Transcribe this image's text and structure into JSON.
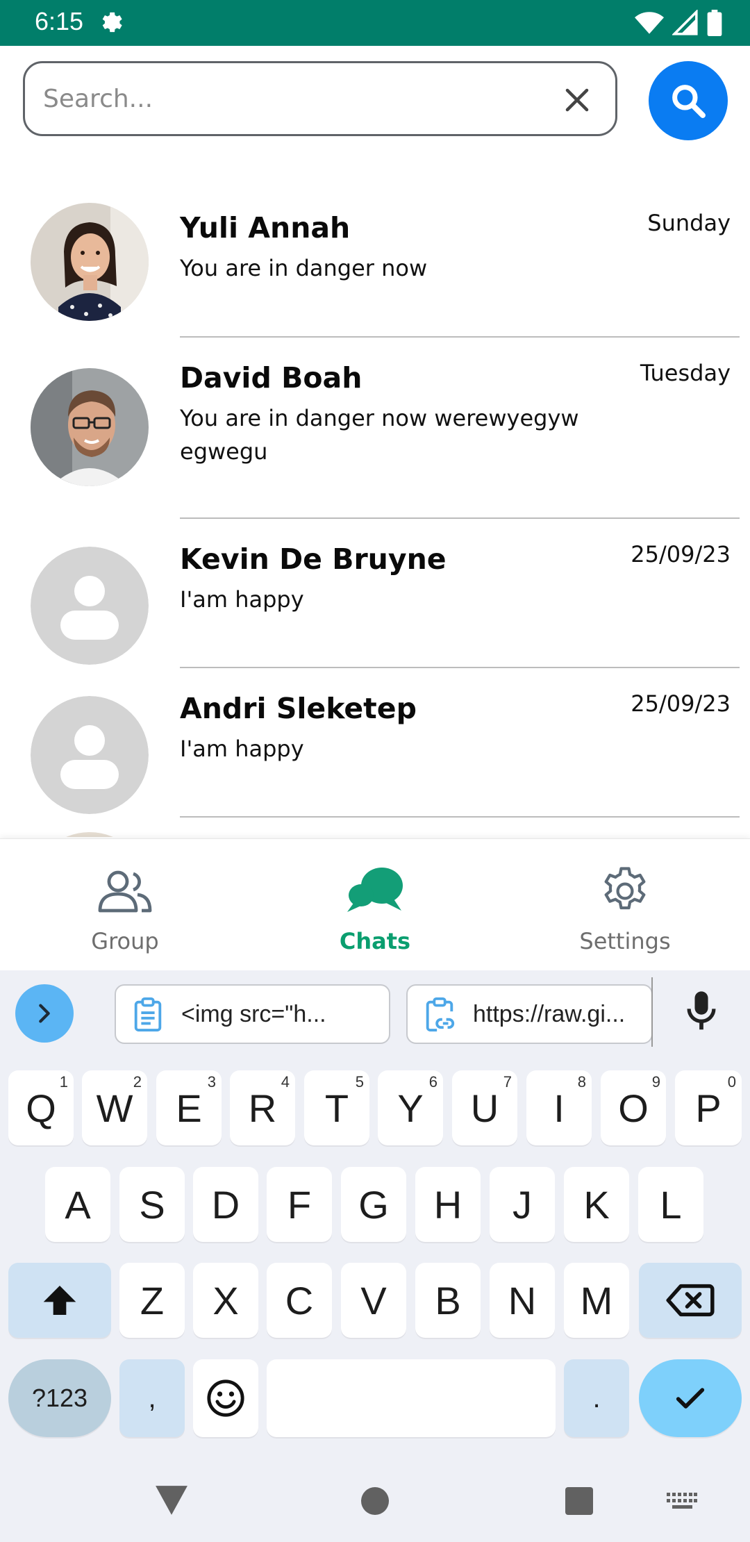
{
  "status_bar": {
    "time": "6:15",
    "icons": [
      "settings-gear-icon",
      "wifi-icon",
      "signal-icon",
      "battery-icon"
    ],
    "background": "#017e6a"
  },
  "search": {
    "placeholder": "Search...",
    "value": "",
    "button_color": "#0a7cf2"
  },
  "chats": [
    {
      "name": "Yuli Annah",
      "message": "You are in danger now",
      "time": "Sunday",
      "avatar": "photo-woman"
    },
    {
      "name": "David Boah",
      "message": "You are in danger now werewyegyw egwegu",
      "time": "Tuesday",
      "avatar": "photo-man"
    },
    {
      "name": "Kevin De Bruyne",
      "message": "I'am happy",
      "time": "25/09/23",
      "avatar": "default-person-icon"
    },
    {
      "name": "Andri Sleketep",
      "message": "I'am happy",
      "time": "25/09/23",
      "avatar": "default-person-icon"
    }
  ],
  "bottom_nav": {
    "items": [
      {
        "label": "Group",
        "icon": "group-icon",
        "active": false
      },
      {
        "label": "Chats",
        "icon": "chat-bubbles-icon",
        "active": true
      },
      {
        "label": "Settings",
        "icon": "gear-icon",
        "active": false
      }
    ],
    "active_color": "#0a9e6f"
  },
  "keyboard": {
    "clipboard": [
      "<img src=\"h...",
      "https://raw.gi..."
    ],
    "row1": [
      {
        "k": "Q",
        "h": "1"
      },
      {
        "k": "W",
        "h": "2"
      },
      {
        "k": "E",
        "h": "3"
      },
      {
        "k": "R",
        "h": "4"
      },
      {
        "k": "T",
        "h": "5"
      },
      {
        "k": "Y",
        "h": "6"
      },
      {
        "k": "U",
        "h": "7"
      },
      {
        "k": "I",
        "h": "8"
      },
      {
        "k": "O",
        "h": "9"
      },
      {
        "k": "P",
        "h": "0"
      }
    ],
    "row2": [
      "A",
      "S",
      "D",
      "F",
      "G",
      "H",
      "J",
      "K",
      "L"
    ],
    "row3": [
      "Z",
      "X",
      "C",
      "V",
      "B",
      "N",
      "M"
    ],
    "mode_label": "?123",
    "comma": ",",
    "period": "."
  }
}
